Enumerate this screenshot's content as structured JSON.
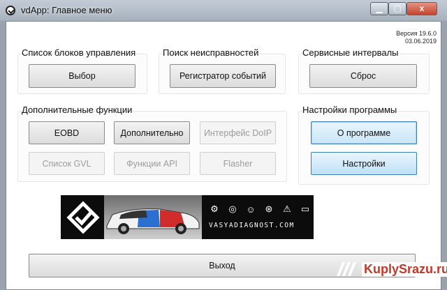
{
  "window": {
    "title": "vdApp: Главное меню",
    "close_glyph": "x"
  },
  "version": {
    "line1": "Версия 19.6.0",
    "line2": "03.06.2019"
  },
  "groups": {
    "control_units": {
      "title": "Список блоков управления",
      "button": "Выбор"
    },
    "fault_search": {
      "title": "Поиск неисправностей",
      "button": "Регистратор событий"
    },
    "service": {
      "title": "Сервисные интервалы",
      "button": "Сброс"
    },
    "extra": {
      "title": "Дополнительные функции",
      "buttons": [
        "EOBD",
        "Дополнительно",
        "Интерфейс DoIP",
        "Список GVL",
        "Функции API",
        "Flasher"
      ]
    },
    "settings": {
      "title": "Настройки программы",
      "buttons": [
        "О программе",
        "Настройки"
      ]
    }
  },
  "banner": {
    "text": "VASYADIAGNOST.COM",
    "icons": [
      "check-engine-icon",
      "abs-icon",
      "airbag-icon",
      "steering-icon",
      "warning-icon",
      "battery-icon"
    ]
  },
  "exit_button": "Выход",
  "watermark": {
    "text": "KuplySrazu.ru",
    "color": "#c0392b"
  }
}
